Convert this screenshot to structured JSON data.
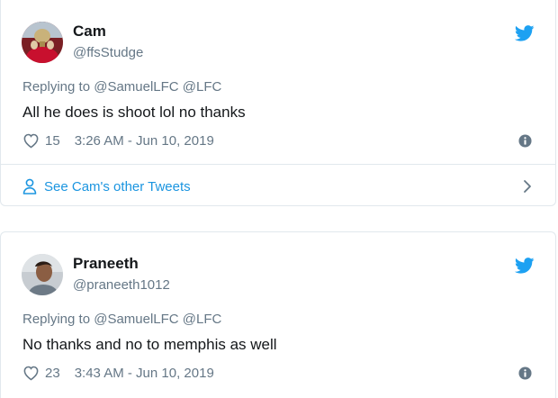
{
  "tweets": [
    {
      "display_name": "Cam",
      "handle": "@ffsStudge",
      "replying_to": "Replying to @SamuelLFC @LFC",
      "text": "All he does is shoot lol no thanks",
      "likes": "15",
      "timestamp": "3:26 AM - Jun 10, 2019",
      "see_more": "See Cam's other Tweets",
      "avatar_icon": "red-trophy-avatar"
    },
    {
      "display_name": "Praneeth",
      "handle": "@praneeth1012",
      "replying_to": "Replying to @SamuelLFC @LFC",
      "text": "No thanks and no to memphis as well",
      "likes": "23",
      "timestamp": "3:43 AM - Jun 10, 2019",
      "avatar_icon": "person-photo-avatar"
    }
  ],
  "colors": {
    "twitter_blue": "#1da1f2",
    "link_blue": "#1b95e0",
    "secondary_text": "#657786",
    "border": "#e1e8ed"
  }
}
